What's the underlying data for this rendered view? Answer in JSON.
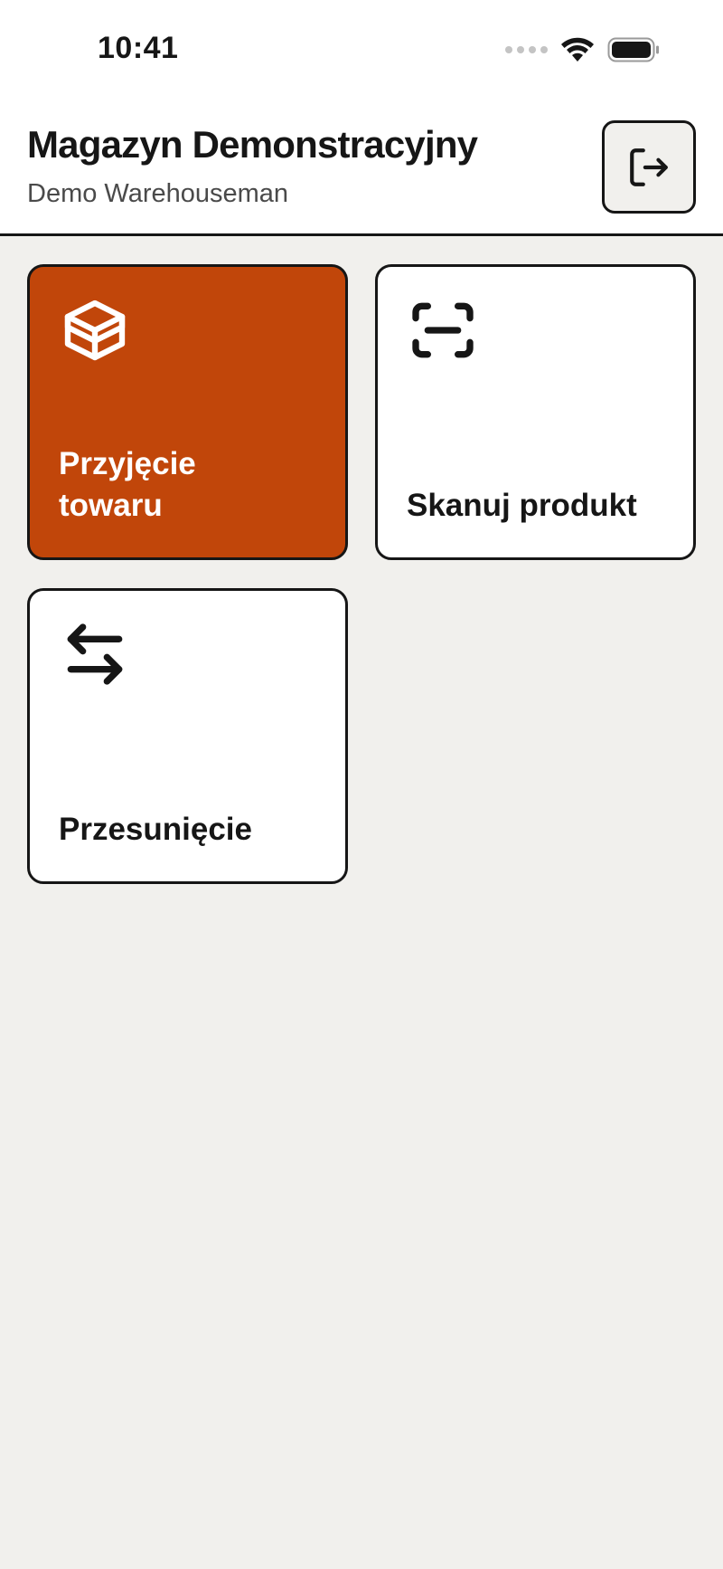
{
  "status_bar": {
    "time": "10:41",
    "icons": [
      "cellular-signal-icon",
      "wifi-icon",
      "battery-icon"
    ]
  },
  "header": {
    "title": "Magazyn Demonstracyjny",
    "subtitle": "Demo Warehouseman",
    "logout_icon": "logout-icon"
  },
  "tiles": [
    {
      "label": "Przyjęcie towaru",
      "icon": "package-icon",
      "style": "primary"
    },
    {
      "label": "Skanuj produkt",
      "icon": "scan-icon",
      "style": "default"
    },
    {
      "label": "Przesunięcie",
      "icon": "transfer-arrows-icon",
      "style": "default"
    }
  ],
  "colors": {
    "accent": "#C1460A",
    "background": "#F1F0ED",
    "surface": "#FFFFFF",
    "text": "#161616"
  }
}
